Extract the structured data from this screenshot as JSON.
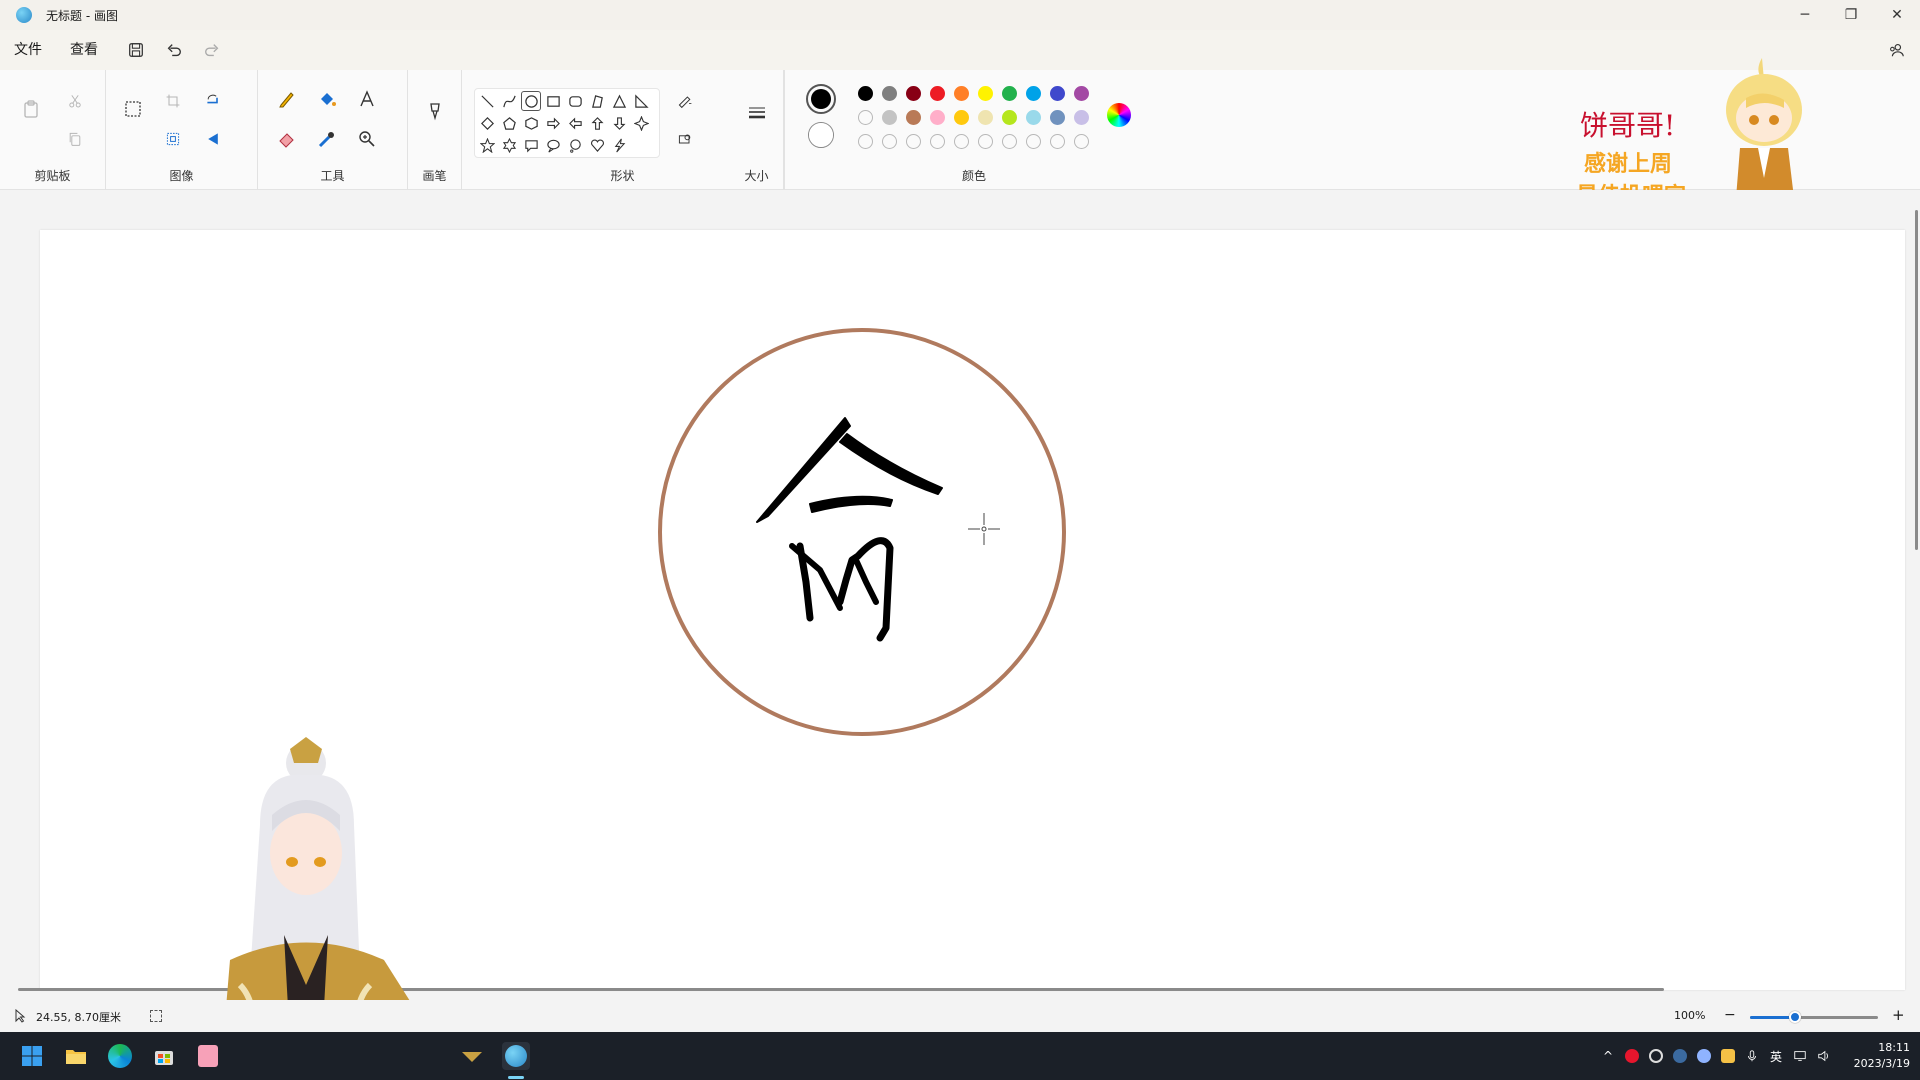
{
  "window": {
    "title": "无标题 - 画图",
    "controls": {
      "minimize": "─",
      "restore": "❐",
      "close": "✕"
    }
  },
  "menu": {
    "file": "文件",
    "view": "查看"
  },
  "ribbon": {
    "groups": {
      "clipboard": "剪贴板",
      "image": "图像",
      "tools": "工具",
      "brushes": "画笔",
      "shapes": "形状",
      "size": "大小",
      "colors": "颜色"
    },
    "palette_row1": [
      "#000000",
      "#7f7f7f",
      "#880015",
      "#ed1c24",
      "#ff7f27",
      "#fff200",
      "#22b14c",
      "#00a2e8",
      "#3f48cc",
      "#a349a4"
    ],
    "palette_row2": [
      "empty",
      "#c3c3c3",
      "#b97a57",
      "#ffaec9",
      "#ffc90e",
      "#efe4b0",
      "#b5e61d",
      "#99d9ea",
      "#7092be",
      "#c8bfe7"
    ],
    "palette_row3": [
      "empty",
      "empty",
      "empty",
      "empty",
      "empty",
      "empty",
      "empty",
      "empty",
      "empty",
      "empty"
    ],
    "primary_color": "#000000",
    "secondary_color": "#ffffff"
  },
  "canvas": {
    "circle_color": "#b07a5e",
    "glyph": "俞"
  },
  "overlay": {
    "banner_line1": "饼哥哥!",
    "banner_line2": "感谢上周",
    "banner_line3": "最佳投喂官"
  },
  "status": {
    "coordinates": "24.55, 8.70厘米",
    "zoom": "100%",
    "zoom_fraction": 0.35
  },
  "taskbar": {
    "tray_lang": "英",
    "time": "18:11",
    "date": "2023/3/19"
  }
}
